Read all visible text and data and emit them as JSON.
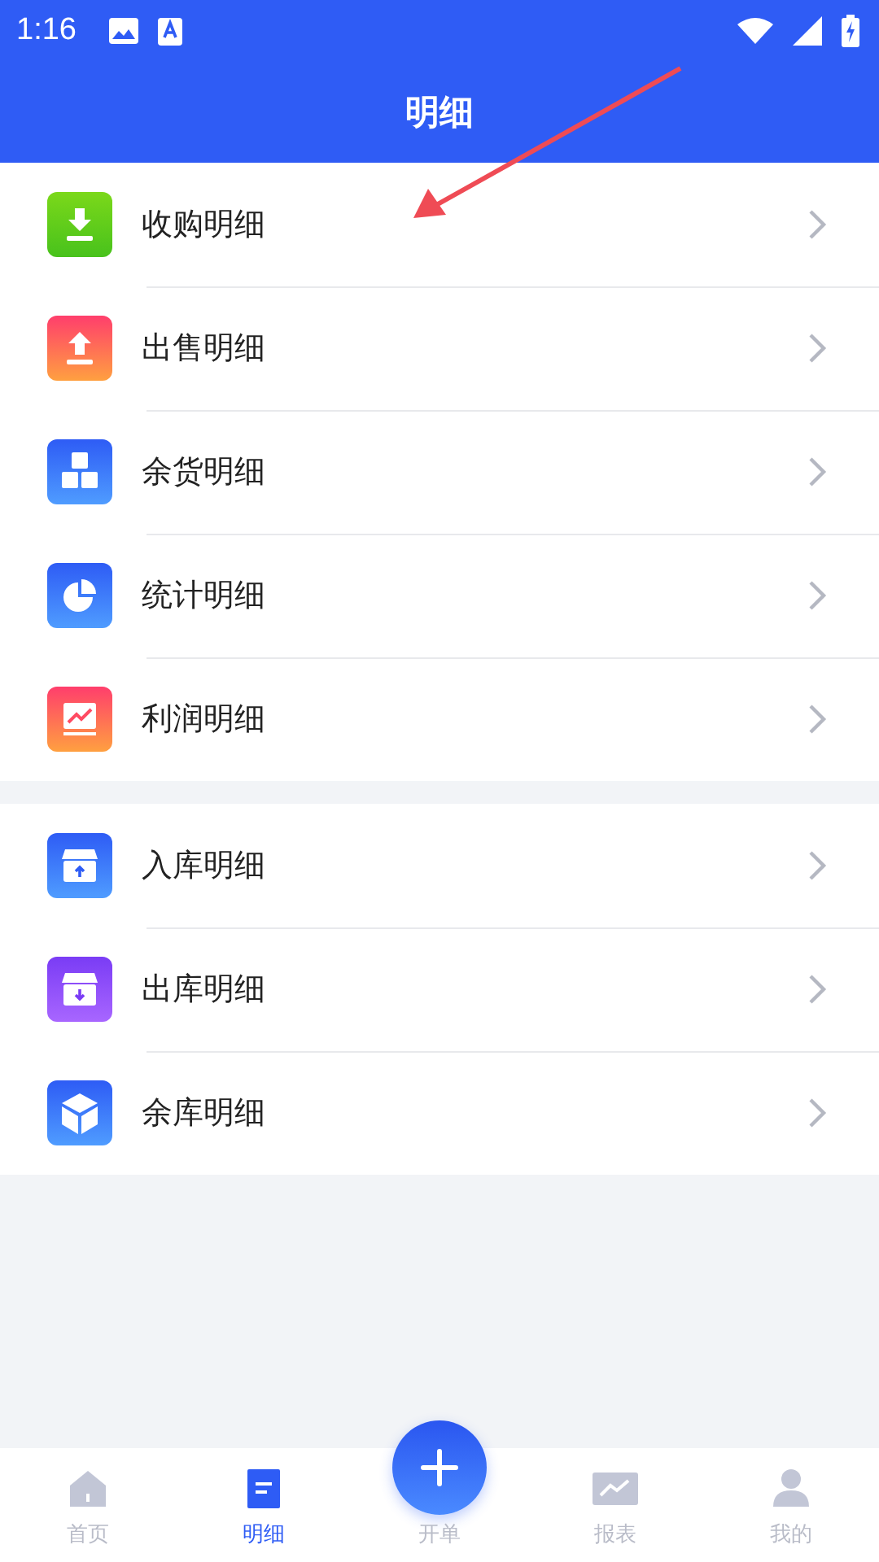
{
  "status_bar": {
    "time": "1:16"
  },
  "header": {
    "title": "明细"
  },
  "groups": [
    {
      "items": [
        {
          "label": "收购明细",
          "kind": "download"
        },
        {
          "label": "出售明细",
          "kind": "upload"
        },
        {
          "label": "余货明细",
          "kind": "boxes"
        },
        {
          "label": "统计明细",
          "kind": "pie"
        },
        {
          "label": "利润明细",
          "kind": "trend"
        }
      ]
    },
    {
      "items": [
        {
          "label": "入库明细",
          "kind": "box-in"
        },
        {
          "label": "出库明细",
          "kind": "box-out"
        },
        {
          "label": "余库明细",
          "kind": "cube"
        }
      ]
    }
  ],
  "tab_bar": [
    {
      "label": "首页",
      "kind": "home",
      "selected": false
    },
    {
      "label": "明细",
      "kind": "list",
      "selected": true
    },
    {
      "label": "开单",
      "kind": "plus",
      "selected": false
    },
    {
      "label": "报表",
      "kind": "chart",
      "selected": false
    },
    {
      "label": "我的",
      "kind": "user",
      "selected": false
    }
  ]
}
